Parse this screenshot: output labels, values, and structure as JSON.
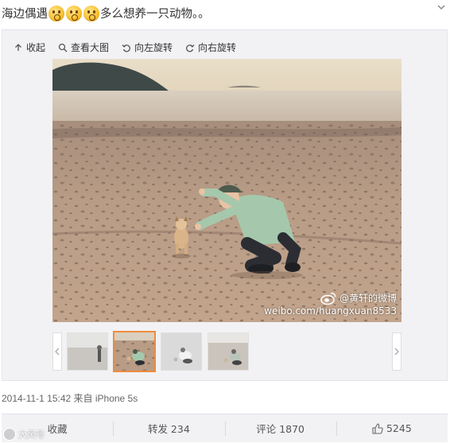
{
  "post": {
    "text_before": "海边偶遇",
    "text_after": "多么想养一只动物。。",
    "emoji_count": 3,
    "emoji_icon": "surprised-face-icon"
  },
  "toolbar": {
    "collapse": "收起",
    "view_large": "查看大图",
    "rotate_left": "向左旋转",
    "rotate_right": "向右旋转"
  },
  "watermark": {
    "handle": "@黄轩的微博",
    "url": "weibo.com/huangxuan8533"
  },
  "thumbnails": {
    "count": 4,
    "active_index": 1,
    "active_color": "#f08b3c"
  },
  "meta": {
    "timestamp_source": "2014-11-1 15:42 来自 iPhone 5s"
  },
  "actions": {
    "favorite": "收藏",
    "repost": "转发 234",
    "comment": "评论 1870",
    "like": "5245"
  },
  "corner_logo": "大风号"
}
